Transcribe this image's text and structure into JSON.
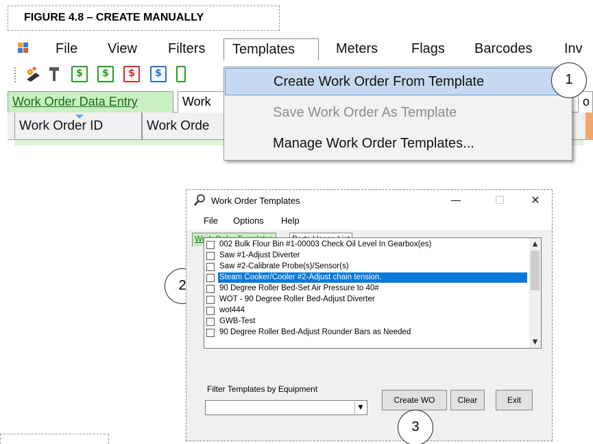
{
  "figure": {
    "caption": "FIGURE 4.8 – CREATE MANUALLY"
  },
  "menubar": {
    "items": [
      "File",
      "View",
      "Filters",
      "Templates",
      "Meters",
      "Flags",
      "Barcodes",
      "Inv"
    ],
    "open_menu": "Templates"
  },
  "toolbar": {
    "icons": [
      "fire-tool-icon",
      "wrench-icon",
      "dollar-doc-green-icon",
      "dollar-doc-green-icon",
      "dollar-doc-red-icon",
      "dollar-doc-blue-icon",
      "dollar-doc-green-icon"
    ],
    "dollar_glyph": "$"
  },
  "main_tabs": [
    {
      "label": "Work Order Data Entry",
      "active": true
    },
    {
      "label": "Work",
      "active": false
    },
    {
      "label": "o",
      "active": false
    }
  ],
  "grid_columns": [
    "Work Order ID",
    "Work Orde"
  ],
  "templates_menu": {
    "items": [
      {
        "label": "Create Work Order From Template",
        "state": "hover"
      },
      {
        "label": "Save Work Order As Template",
        "state": "disabled"
      },
      {
        "label": "Manage Work Order Templates...",
        "state": "normal"
      }
    ]
  },
  "callouts": [
    "1",
    "2",
    "3"
  ],
  "dialog": {
    "title": "Work Order Templates",
    "window_buttons": {
      "minimize": "—",
      "maximize": "☐",
      "close": "✕"
    },
    "menu": [
      "File",
      "Options",
      "Help"
    ],
    "tabs": [
      {
        "label": "Work Order Templates",
        "active": true
      },
      {
        "label": "Parts Usage List",
        "active": false
      }
    ],
    "templates": [
      {
        "label": "002 Bulk Flour Bin #1-00003 Check Oil Level In Gearbox(es)",
        "selected": false
      },
      {
        "label": "Saw #1-Adjust Diverter",
        "selected": false
      },
      {
        "label": "Saw #2-Calibrate Probe(s)/Sensor(s)",
        "selected": false
      },
      {
        "label": "Steam Cooker/Cooler #2-Adjust chain tension.",
        "selected": true
      },
      {
        "label": "90 Degree Roller Bed-Set Air Pressure to 40#",
        "selected": false
      },
      {
        "label": "WOT - 90 Degree Roller Bed-Adjust Diverter",
        "selected": false
      },
      {
        "label": "wot444",
        "selected": false
      },
      {
        "label": "GWB-Test",
        "selected": false
      },
      {
        "label": "90 Degree Roller Bed-Adjust Rounder Bars as Needed",
        "selected": false
      }
    ],
    "scroll": {
      "up": "▲",
      "down": "▼"
    },
    "filter_label": "Filter Templates by Equipment",
    "filter_value": "",
    "buttons": {
      "create": "Create WO",
      "clear": "Clear",
      "exit": "Exit"
    }
  }
}
